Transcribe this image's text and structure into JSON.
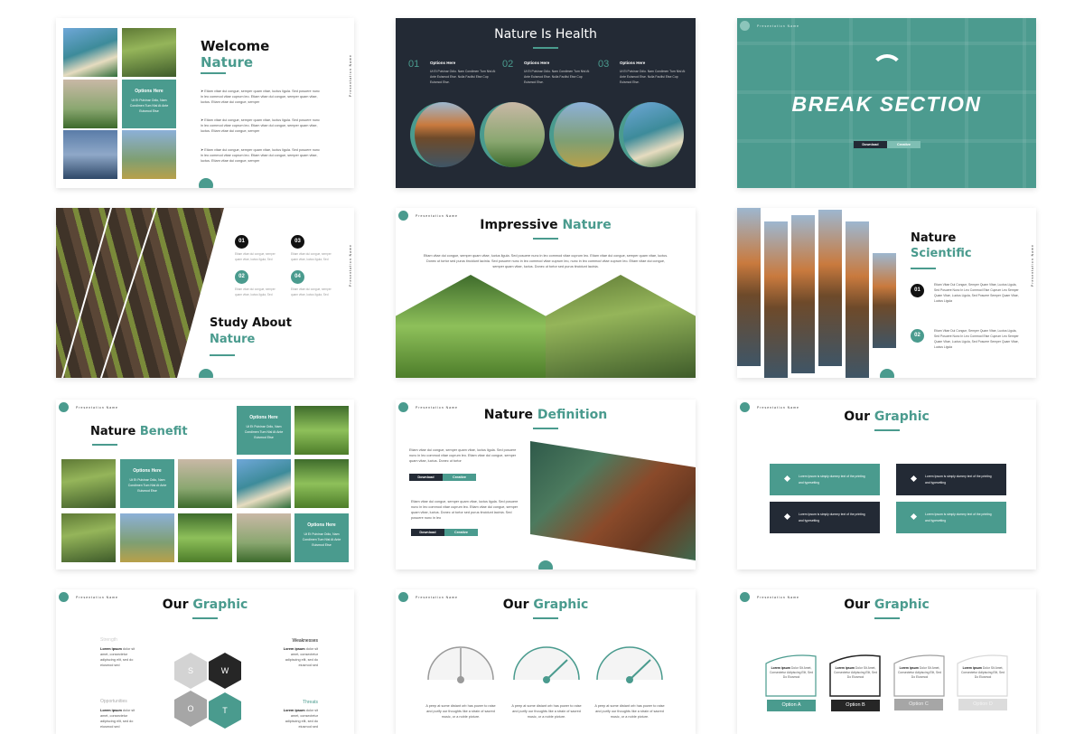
{
  "colors": {
    "accent": "#4a9b8e",
    "dark": "#232a35"
  },
  "presentation_name": "Presentation Name",
  "lorem": {
    "bullet": "Etiam vitae dui congue, semper quam vitae, luctus ligula. Sed posuere nunc in leo commod vitae cuprum leo. Etiam vitae dui congue, semper quam vitae, luctus. Etiam vitae dui congue, semper",
    "options_desc": "Ut Et Pulvinar Odio, Nam Condimen Tum Nisl At Ante Euismod Etse",
    "health_desc": "Ut Et Pulvinar Odio. Nam Condimen Tum Nisl At Ante Euismod Etse. Nulla Facilisi Etse Cup Euismod Etse.",
    "study": "Etiam vitae dui congue, semper quam vitae, luctus ligula, Sed",
    "scientific": "Etiam Vitae Dui Congue, Semper Quam Vitae, Luctus Ligula, Sed Posuere Nunc In Leo Commod Etse Cuprum Leo Semper Quam Vitae, Luctus Ligula, Sed Posuere Semper Quam Vitae, Luctus Ligula",
    "impressive": "Etiam vitae dui congue, semper quam vitae, luctus ligula. Sed posuere nunc in leo commod vitae cuprum leo. Etiam vitae dui congue, semper quam vitae, luctus. Donec ut tortor sed purus tincidunt lacinia. Sed posuere nunc in leo commod vitae cuprum leo, nunc in leo commod vitae cuprum leo. Etiam vitae dui congue, semper quam vitae, luctus. Donec ut tortor sed purus tincidunt lacinia.",
    "def1": "Etiam vitae dui congue, semper quam vitae, luctus ligula. Sed posuere nunc in leo commod vitae cuprum leo. Etiam vitae dui congue, semper quam vitae, luctus. Donec ut tortor",
    "def2": "Etiam vitae dui congue, semper quam vitae, luctus ligula. Sed posuere nunc in leo commod vitae cuprum leo. Etiam vitae dui congue, semper quam vitae, luctus. Donec ut tortor sed purus tincidunt lacinia. Sed posuere nunc in leo",
    "graphic_box": "Lorem Ipsum is simply dummy text of the printing and typesetting",
    "swot": "dolor sit amet, consectetur adipiscing elit, sed do eiusmod sed",
    "swot_bold": "Lorem ipsum",
    "gauge": "A peep at some distant orb has power to raise and purify our thoughts like a strain of sacred music, or a noble picture.",
    "wave": "Dolor Sit Amet, Consectetur Adipiscing Elit, Sed Do Eiusmod"
  },
  "options_here": "Options Here",
  "download": "Download",
  "creative": "Creative",
  "s1": {
    "title1": "Welcome",
    "title2": "Nature"
  },
  "s2": {
    "title": "Nature Is Health",
    "nums": [
      "01",
      "02",
      "03"
    ]
  },
  "s3": {
    "title": "BREAK SECTION"
  },
  "s4": {
    "title1": "Study About",
    "title2": "Nature",
    "nums": [
      "01",
      "02",
      "03",
      "04"
    ]
  },
  "s5": {
    "title1": "Impressive",
    "title2": "Nature"
  },
  "s6": {
    "title1": "Nature",
    "title2": "Scientific",
    "nums": [
      "01",
      "02"
    ]
  },
  "s7": {
    "title1": "Nature",
    "title2": "Benefit"
  },
  "s8": {
    "title1": "Nature",
    "title2": "Definition"
  },
  "graphic": {
    "title1": "Our",
    "title2": "Graphic"
  },
  "swot": {
    "letters": [
      "S",
      "W",
      "O",
      "T"
    ],
    "labels": [
      "Strength",
      "Weaknesses",
      "Opportunities",
      "Threats"
    ]
  },
  "options": [
    "Option A",
    "Option B",
    "Option C",
    "Option D"
  ]
}
